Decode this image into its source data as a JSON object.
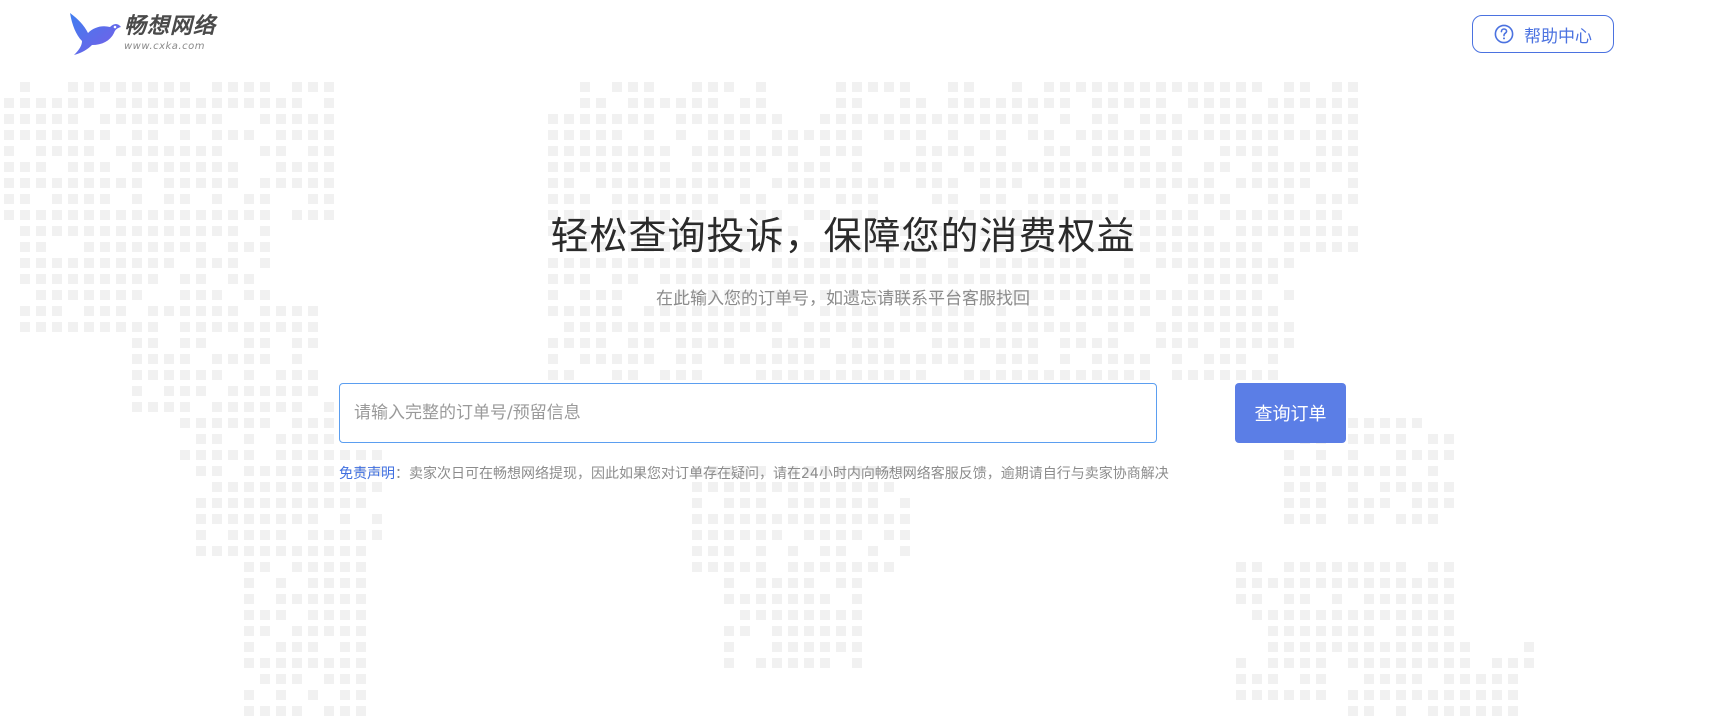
{
  "header": {
    "logo": {
      "name": "畅想网络",
      "url": "www.cxka.com"
    },
    "help_button": {
      "label": "帮助中心",
      "icon": "question-circle-icon"
    }
  },
  "hero": {
    "title": "轻松查询投诉，保障您的消费权益",
    "subtitle": "在此输入您的订单号，如遗忘请联系平台客服找回"
  },
  "search": {
    "placeholder": "请输入完整的订单号/预留信息",
    "value": "",
    "button_label": "查询订单"
  },
  "disclaimer": {
    "label": "免责声明",
    "separator": "：",
    "text": "卖家次日可在畅想网络提现，因此如果您对订单存在疑问，请在24小时内向畅想网络客服反馈，逾期请自行与卖家协商解决"
  },
  "colors": {
    "accent": "#4b72e0",
    "button_bg": "#5b7ee6",
    "input_border": "#5b9ef0",
    "map_dot": "#f1f1f1",
    "title_text": "#2b2b2b",
    "muted_text": "#8c8c8c"
  }
}
